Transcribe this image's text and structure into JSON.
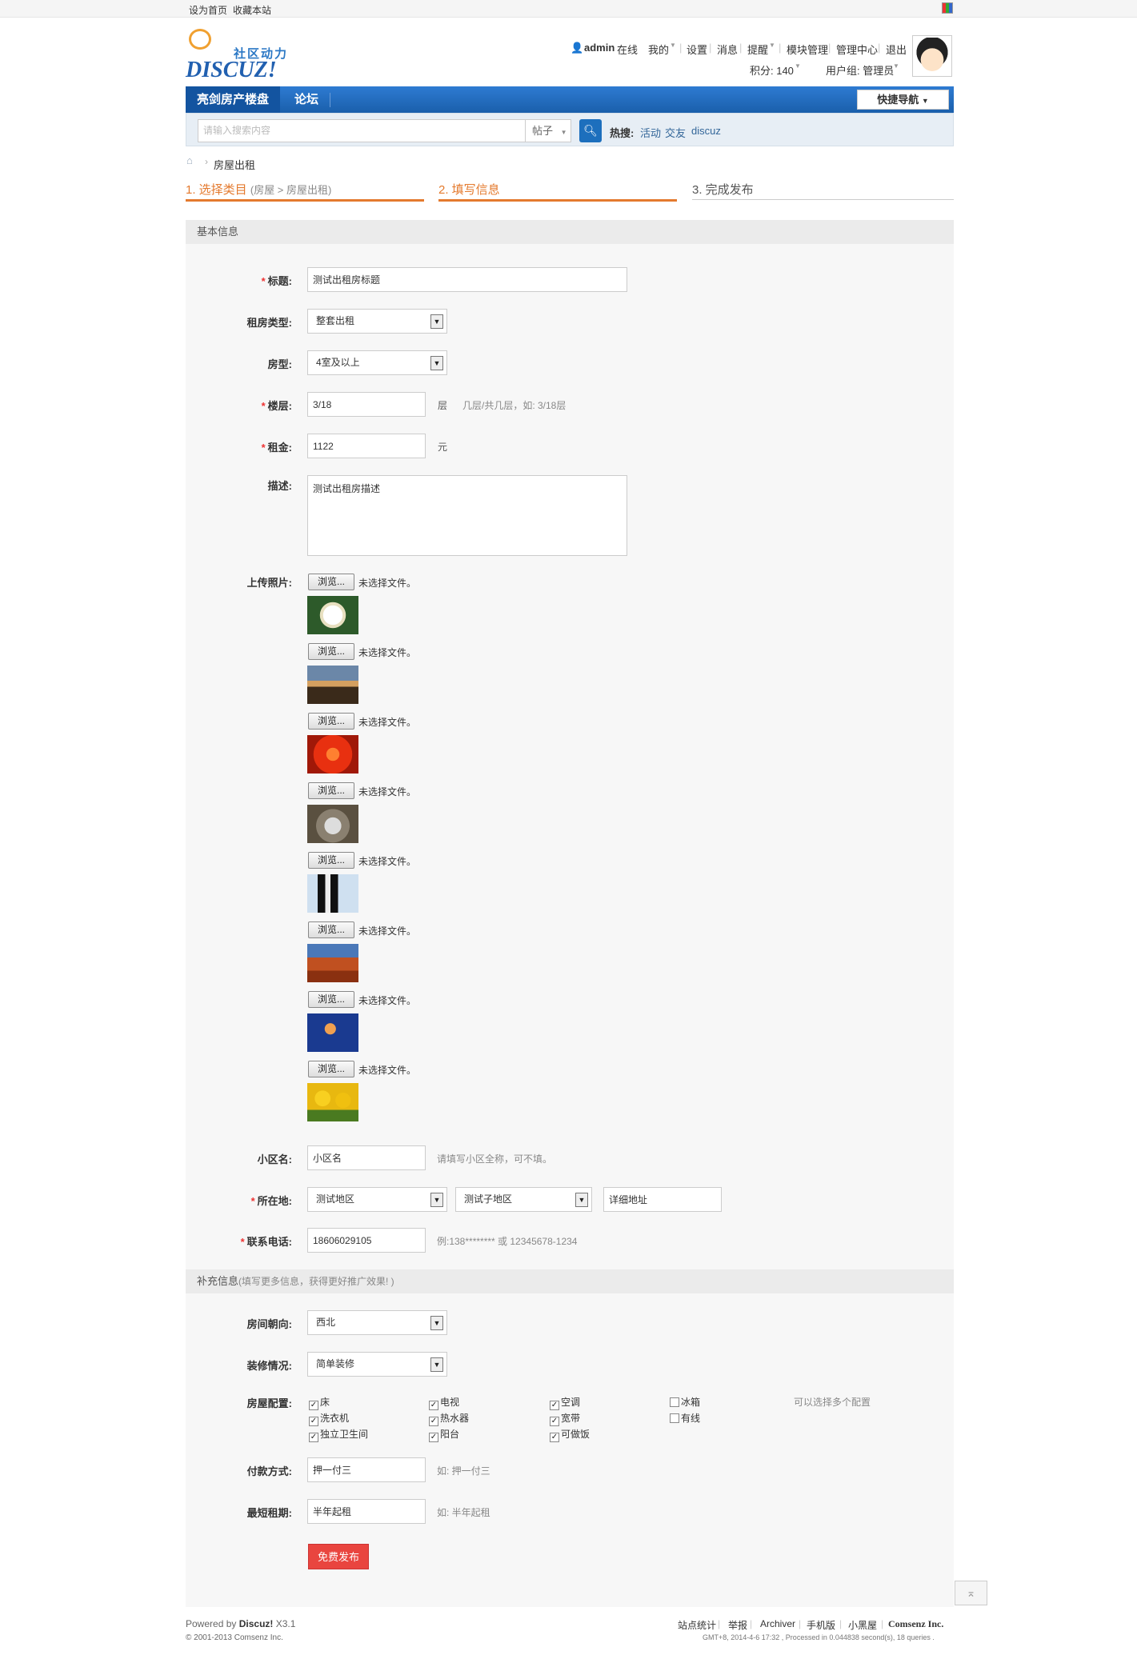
{
  "topbar": {
    "set_home": "设为首页",
    "bookmark": "收藏本站"
  },
  "logo": {
    "cn": "社区动力",
    "en": "DISCUZ!"
  },
  "user": {
    "name": "admin",
    "status": "在线",
    "mine": "我的",
    "settings": "设置",
    "messages": "消息",
    "reminders": "提醒",
    "module_admin": "模块管理",
    "admin_center": "管理中心",
    "logout": "退出",
    "points_label": "积分: 140",
    "usergroup_label": "用户组: 管理员"
  },
  "nav": {
    "item1": "亮剑房产楼盘",
    "item2": "论坛",
    "quick_nav": "快捷导航"
  },
  "search": {
    "placeholder": "请输入搜索内容",
    "type": "帖子",
    "hot_label": "热搜:",
    "hot": [
      "活动",
      "交友",
      "discuz"
    ]
  },
  "breadcrumb": {
    "current": "房屋出租"
  },
  "steps": {
    "step1": "1. 选择类目",
    "step1_sub": "(房屋 > 房屋出租)",
    "step2": "2. 填写信息",
    "step3": "3. 完成发布"
  },
  "basic_section": {
    "title": "基本信息"
  },
  "fields": {
    "title": {
      "label": "标题:",
      "value": "测试出租房标题"
    },
    "rent_type": {
      "label": "租房类型:",
      "value": "整套出租"
    },
    "room_type": {
      "label": "房型:",
      "value": "4室及以上"
    },
    "floor": {
      "label": "楼层:",
      "value": "3/18",
      "unit": "层",
      "hint": "几层/共几层，如: 3/18层"
    },
    "rent": {
      "label": "租金:",
      "value": "1122",
      "unit": "元"
    },
    "desc": {
      "label": "描述:",
      "value": "测试出租房描述"
    },
    "photos": {
      "label": "上传照片:",
      "browse": "浏览...",
      "no_file": "未选择文件。"
    },
    "community": {
      "label": "小区名:",
      "value": "小区名",
      "hint": "请填写小区全称，可不填。"
    },
    "location": {
      "label": "所在地:",
      "region": "测试地区",
      "subregion": "测试子地区",
      "address": "详细地址"
    },
    "phone": {
      "label": "联系电话:",
      "value": "18606029105",
      "hint": "例:138******** 或 12345678-1234"
    }
  },
  "extra_section": {
    "title": "补充信息",
    "sub": "(填写更多信息，获得更好推广效果! )"
  },
  "extra": {
    "orientation": {
      "label": "房间朝向:",
      "value": "西北"
    },
    "decoration": {
      "label": "装修情况:",
      "value": "简单装修"
    },
    "config": {
      "label": "房屋配置:",
      "hint": "可以选择多个配置",
      "items": [
        {
          "label": "床",
          "checked": true
        },
        {
          "label": "电视",
          "checked": true
        },
        {
          "label": "空调",
          "checked": true
        },
        {
          "label": "冰箱",
          "checked": false
        },
        {
          "label": "洗衣机",
          "checked": true
        },
        {
          "label": "热水器",
          "checked": true
        },
        {
          "label": "宽带",
          "checked": true
        },
        {
          "label": "有线",
          "checked": false
        },
        {
          "label": "独立卫生间",
          "checked": true
        },
        {
          "label": "阳台",
          "checked": true
        },
        {
          "label": "可做饭",
          "checked": true
        }
      ]
    },
    "payment": {
      "label": "付款方式:",
      "value": "押一付三",
      "hint": "如: 押一付三"
    },
    "min_term": {
      "label": "最短租期:",
      "value": "半年起租",
      "hint": "如: 半年起租"
    }
  },
  "submit": "免费发布",
  "footer": {
    "powered_prefix": "Powered by",
    "powered_brand": "Discuz!",
    "powered_ver": "X3.1",
    "copyright": "© 2001-2013 Comsenz Inc.",
    "links": [
      "站点统计",
      "举报",
      "Archiver",
      "手机版",
      "小黑屋"
    ],
    "company": "Comsenz Inc.",
    "stats": "GMT+8, 2014-4-6 17:32 , Processed in 0.044838 second(s), 18 queries ."
  },
  "colors": {
    "nav": "#1a5fab",
    "accent": "#e47a2e",
    "submit": "#e9453f",
    "link": "#336699"
  }
}
